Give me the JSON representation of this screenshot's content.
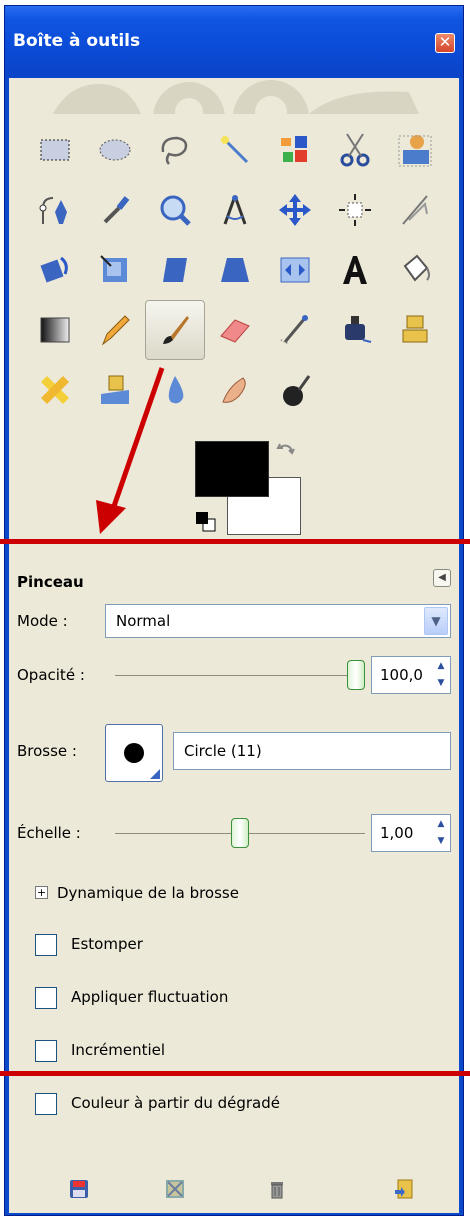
{
  "window": {
    "title": "Boîte à outils",
    "close_icon": "close-icon"
  },
  "tools": [
    {
      "name": "rect-select-icon"
    },
    {
      "name": "ellipse-select-icon"
    },
    {
      "name": "free-select-icon"
    },
    {
      "name": "fuzzy-select-icon"
    },
    {
      "name": "color-select-icon"
    },
    {
      "name": "scissors-select-icon"
    },
    {
      "name": "foreground-select-icon"
    },
    {
      "name": "paths-icon"
    },
    {
      "name": "color-picker-icon"
    },
    {
      "name": "zoom-icon"
    },
    {
      "name": "measure-icon"
    },
    {
      "name": "move-icon"
    },
    {
      "name": "align-icon"
    },
    {
      "name": "crop-icon"
    },
    {
      "name": "rotate-icon"
    },
    {
      "name": "scale-icon"
    },
    {
      "name": "shear-icon"
    },
    {
      "name": "perspective-icon"
    },
    {
      "name": "flip-icon"
    },
    {
      "name": "text-icon"
    },
    {
      "name": "bucket-fill-icon"
    },
    {
      "name": "blend-icon"
    },
    {
      "name": "pencil-icon"
    },
    {
      "name": "paintbrush-icon",
      "active": true
    },
    {
      "name": "eraser-icon"
    },
    {
      "name": "airbrush-icon"
    },
    {
      "name": "ink-icon"
    },
    {
      "name": "clone-icon"
    },
    {
      "name": "heal-icon"
    },
    {
      "name": "perspective-clone-icon"
    },
    {
      "name": "blur-icon"
    },
    {
      "name": "smudge-icon"
    },
    {
      "name": "dodge-burn-icon"
    }
  ],
  "colors": {
    "foreground": "#000000",
    "background": "#ffffff"
  },
  "options": {
    "title": "Pinceau",
    "mode_label": "Mode :",
    "mode_value": "Normal",
    "opacity_label": "Opacité :",
    "opacity_value": "100,0",
    "opacity_level": 1.0,
    "brush_label": "Brosse :",
    "brush_name": "Circle (11)",
    "scale_label": "Échelle :",
    "scale_value": "1,00",
    "scale_level": 0.5,
    "dynamics_label": "Dynamique de la brosse",
    "checkboxes": [
      {
        "label": "Estomper",
        "checked": false
      },
      {
        "label": "Appliquer fluctuation",
        "checked": false
      },
      {
        "label": "Incrémentiel",
        "checked": false
      },
      {
        "label": "Couleur à partir du dégradé",
        "checked": false
      }
    ]
  },
  "bottom_icons": [
    "save-preset-icon",
    "restore-preset-icon",
    "delete-preset-icon",
    "reset-icon"
  ],
  "annotation": {
    "line_color": "#cc0000",
    "arrow_color": "#cc0000"
  }
}
